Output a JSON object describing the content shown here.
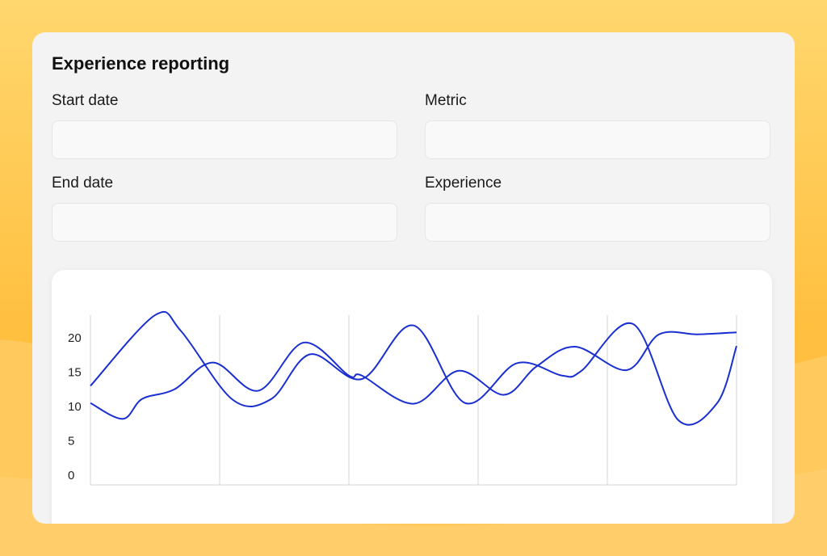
{
  "form": {
    "title": "Experience reporting",
    "fields": {
      "start_date": {
        "label": "Start date",
        "value": "",
        "placeholder": ""
      },
      "metric": {
        "label": "Metric",
        "value": "",
        "placeholder": ""
      },
      "end_date": {
        "label": "End date",
        "value": "",
        "placeholder": ""
      },
      "experience": {
        "label": "Experience",
        "value": "",
        "placeholder": ""
      }
    }
  },
  "colors": {
    "background": "#ffc85a",
    "panel": "#f3f3f3",
    "series": "#1a2fd0"
  },
  "chart_data": {
    "type": "line",
    "title": "",
    "xlabel": "",
    "ylabel": "",
    "ylim": [
      0,
      20
    ],
    "yticks": [
      0,
      5,
      10,
      15,
      20
    ],
    "xlim": [
      0,
      10
    ],
    "x_gridlines": [
      2,
      4,
      6,
      8
    ],
    "series": [
      {
        "name": "",
        "x": [
          0,
          1.0,
          1.4,
          2.2,
          2.8,
          3.4,
          4.2,
          5.0,
          5.8,
          6.6,
          7.3,
          7.6,
          8.4,
          9.1,
          9.7,
          10.0
        ],
        "y": [
          13,
          23.3,
          21.0,
          11.0,
          11.1,
          17.6,
          14.0,
          21.8,
          10.5,
          16.3,
          14.5,
          15.2,
          22.0,
          8.0,
          10.5,
          18.8
        ]
      },
      {
        "name": "",
        "x": [
          0,
          0.5,
          0.8,
          1.3,
          1.9,
          2.6,
          3.3,
          4.0,
          4.2,
          5.0,
          5.7,
          6.4,
          6.9,
          7.5,
          8.3,
          8.8,
          9.4,
          10.0
        ],
        "y": [
          10.5,
          8.2,
          11.1,
          12.5,
          16.4,
          12.3,
          19.3,
          14.5,
          14.5,
          10.4,
          15.2,
          11.7,
          15.8,
          18.7,
          15.3,
          20.5,
          20.5,
          20.8
        ]
      }
    ]
  }
}
